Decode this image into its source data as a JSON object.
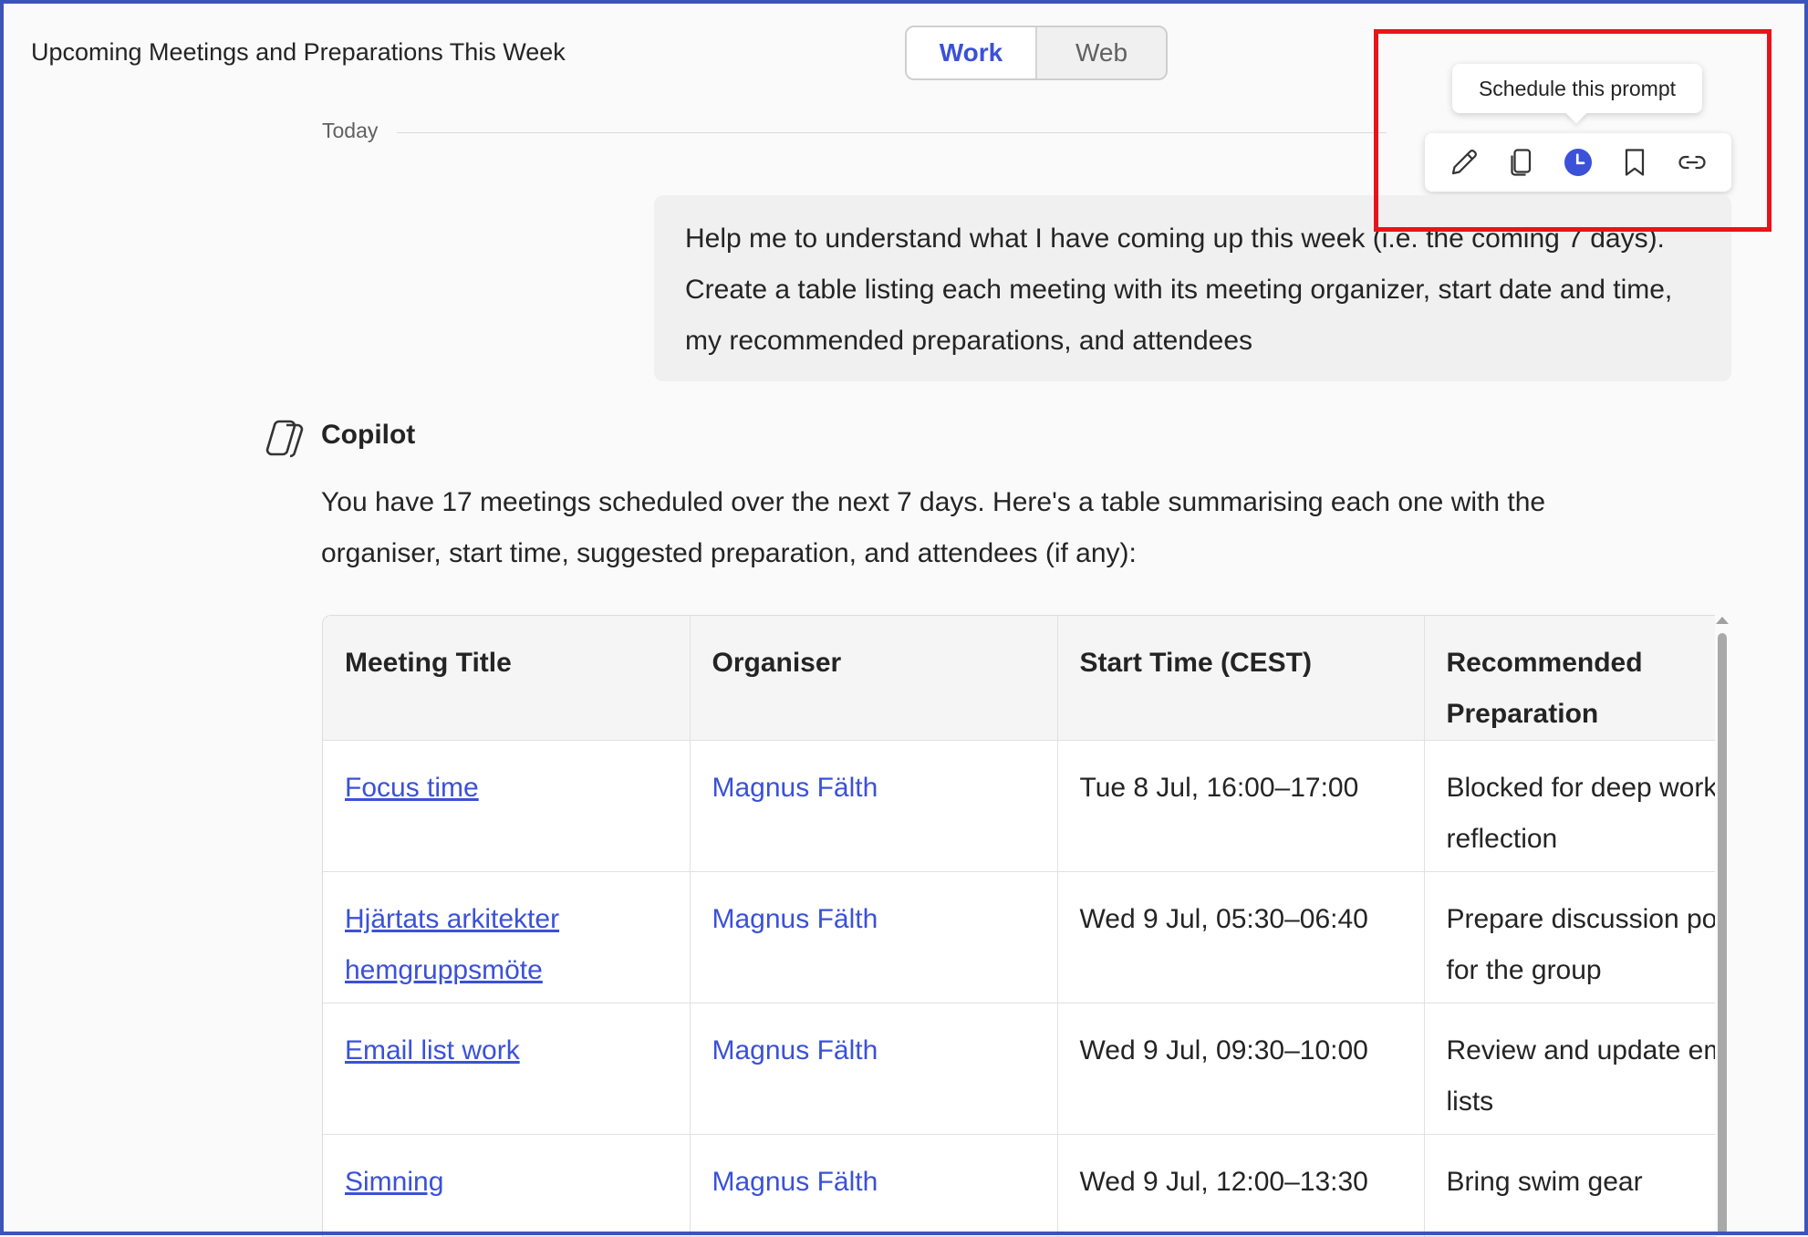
{
  "header": {
    "title": "Upcoming Meetings and Preparations This Week",
    "toggle": {
      "work": "Work",
      "web": "Web"
    }
  },
  "divider": {
    "label": "Today"
  },
  "tooltip": {
    "text": "Schedule this prompt"
  },
  "prompt_toolbar": {
    "icons": [
      "edit-icon",
      "copy-icon",
      "schedule-clock-icon",
      "bookmark-icon",
      "link-icon"
    ]
  },
  "user_prompt": {
    "text": "Help me to understand what I have coming up this week (i.e. the coming 7 days). Create a table listing each meeting with its meeting organizer, start date and time, my recommended preparations, and attendees"
  },
  "copilot": {
    "name": "Copilot",
    "intro": "You have 17 meetings scheduled over the next 7 days. Here's a table summarising each one with the organiser, start time, suggested preparation, and attendees (if any):"
  },
  "table": {
    "headers": [
      "Meeting Title",
      "Organiser",
      "Start Time (CEST)",
      "Recommended Preparation"
    ],
    "rows": [
      {
        "title": "Focus time",
        "organiser": "Magnus Fälth",
        "start": "Tue 8 Jul, 16:00–17:00",
        "prep": "Blocked for deep work or reflection"
      },
      {
        "title": "Hjärtats arkitekter hemgruppsmöte",
        "organiser": "Magnus Fälth",
        "start": "Wed 9 Jul, 05:30–06:40",
        "prep": "Prepare discussion points for the group"
      },
      {
        "title": "Email list work",
        "organiser": "Magnus Fälth",
        "start": "Wed 9 Jul, 09:30–10:00",
        "prep": "Review and update email lists"
      },
      {
        "title": "Simning",
        "organiser": "Magnus Fälth",
        "start": "Wed 9 Jul, 12:00–13:30",
        "prep": "Bring swim gear"
      }
    ]
  },
  "colors": {
    "accent": "#3a51d8",
    "highlight_box": "#e8141b"
  }
}
